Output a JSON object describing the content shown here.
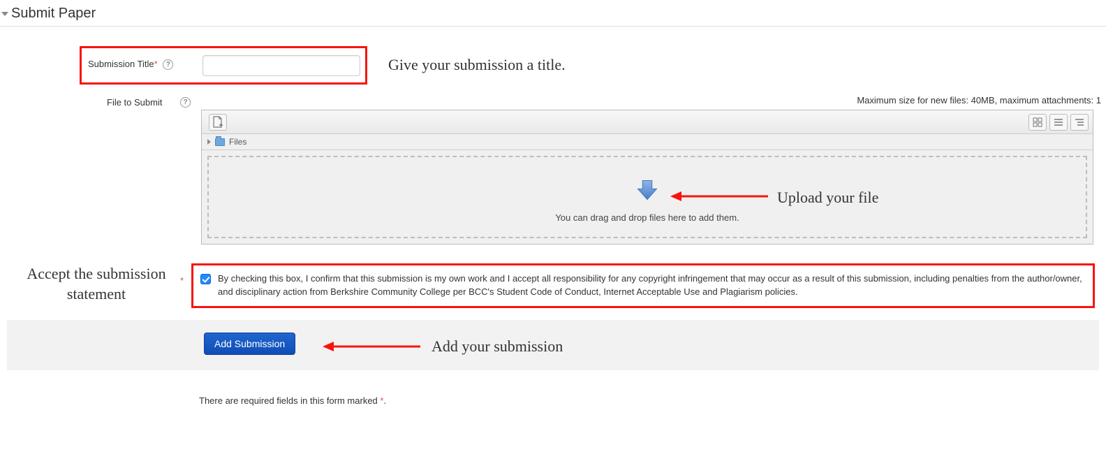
{
  "section": {
    "title": "Submit Paper"
  },
  "form": {
    "title_label": "Submission Title",
    "title_value": "",
    "file_label": "File to Submit",
    "max_note": "Maximum size for new files: 40MB, maximum attachments: 1",
    "files_tree_label": "Files",
    "drop_hint": "You can drag and drop files here to add them.",
    "statement": "By checking this box, I confirm that this submission is my own work and I accept all responsibility for any copyright infringement that may occur as a result of this submission, including penalties from the author/owner, and disciplinary action from Berkshire Community College per BCC's Student Code of Conduct, Internet Acceptable Use and Plagiarism policies.",
    "statement_checked": true,
    "submit_label": "Add Submission",
    "required_note_prefix": "There are required fields in this form marked ",
    "required_note_suffix": "."
  },
  "annotations": {
    "give_title": "Give your submission a title.",
    "upload_file": "Upload your file",
    "accept_statement": "Accept the submission statement",
    "add_submission": "Add your submission"
  }
}
